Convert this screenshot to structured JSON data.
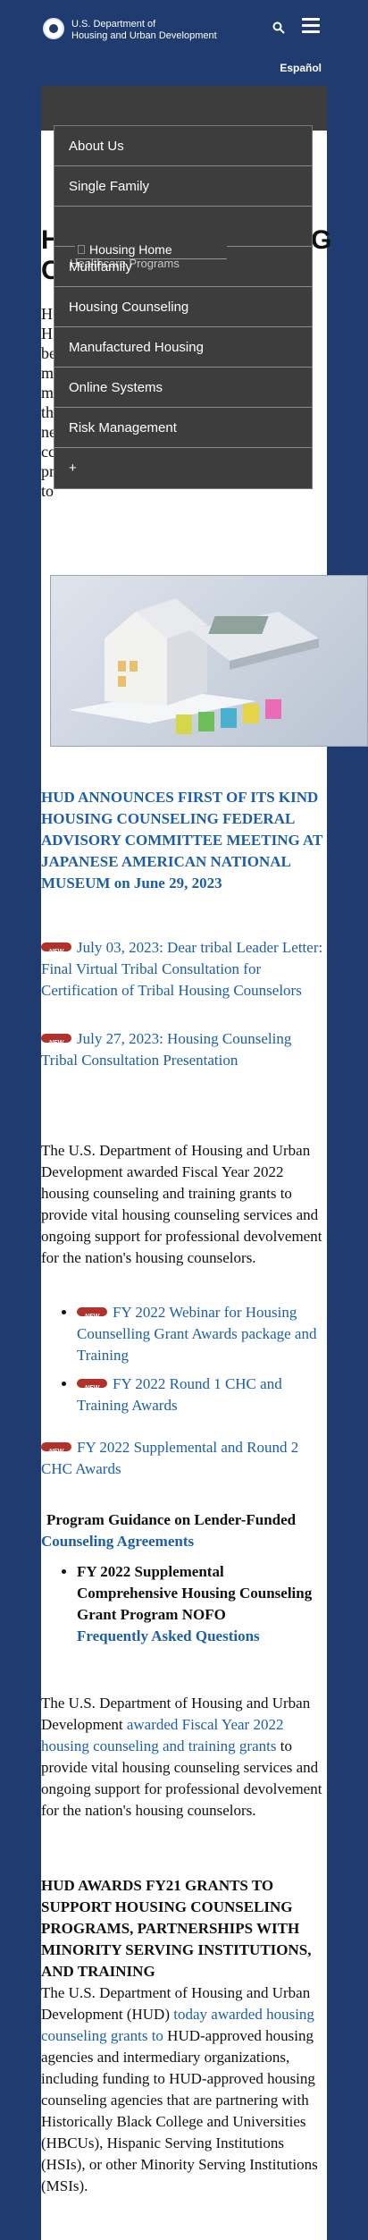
{
  "header": {
    "agency_line1": "U.S. Department of",
    "agency_line2": "Housing and Urban Development",
    "espanol": "Español"
  },
  "obscured": {
    "heading_line1": "H",
    "heading_line2": "C",
    "heading_right": "G",
    "sub_item": "Housing Home",
    "submenu_peek": "Healthcare Programs"
  },
  "menu": {
    "items": [
      "About Us",
      "Single Family",
      "Housing Home",
      "Multifamily",
      "Housing Counseling",
      "Manufactured Housing",
      "Online Systems",
      "Risk Management",
      "+"
    ]
  },
  "hero": {
    "alt": "house and calculator on documents"
  },
  "content": {
    "announce_heading": "HUD ANNOUNCES FIRST OF ITS KIND HOUSING COUNSELING FEDERAL ADVISORY COMMITTEE MEETING AT JAPANESE AMERICAN NATIONAL MUSEUM on June 29, 2023",
    "link1": "July 03, 2023: Dear tribal Leader Letter: Final Virtual Tribal Consultation for Certification of Tribal Housing Counselors",
    "link2": "July 27, 2023: Housing Counseling Tribal Consultation Presentation",
    "para1": "The U.S. Department of Housing and Urban Development awarded Fiscal Year 2022 housing counseling and training grants to provide vital housing counseling services and ongoing support for professional devolvement for the nation's housing counselors.",
    "bullet1": "FY 2022 Webinar for Housing Counselling Grant Awards package and Training",
    "bullet2": "FY 2022 Round 1 CHC and Training Awards",
    "link3": "FY 2022 Supplemental and Round 2 CHC Awards",
    "guidance_bold": "Program Guidance on Lender-Funded",
    "guidance_link": "Counseling Agreements",
    "nofo_bold": "FY 2022 Supplemental Comprehensive Housing Counseling Grant Program NOFO",
    "nofo_link": "Frequently Asked Questions",
    "para2_a": "The U.S. Department of Housing and Urban Development ",
    "para2_link": "awarded Fiscal Year 2022 housing counseling and training grants",
    "para2_b": " to provide vital housing counseling services and ongoing support for professional devolvement for the nation's housing counselors.",
    "fy21_heading": "HUD AWARDS FY21 GRANTS TO SUPPORT HOUSING COUNSELING PROGRAMS, PARTNERSHIPS WITH MINORITY SERVING INSTITUTIONS, AND TRAINING",
    "para3_a": "The U.S. Department of Housing and Urban Development (HUD) ",
    "para3_link": "today awarded housing counseling grants to",
    "para3_b": " HUD-approved housing agencies and intermediary organizations, including funding to HUD-approved housing counseling agencies that are partnering with Historically Black College and Universities (HBCUs), Hispanic Serving Institutions (HSIs), or other Minority Serving Institutions (MSIs)."
  }
}
